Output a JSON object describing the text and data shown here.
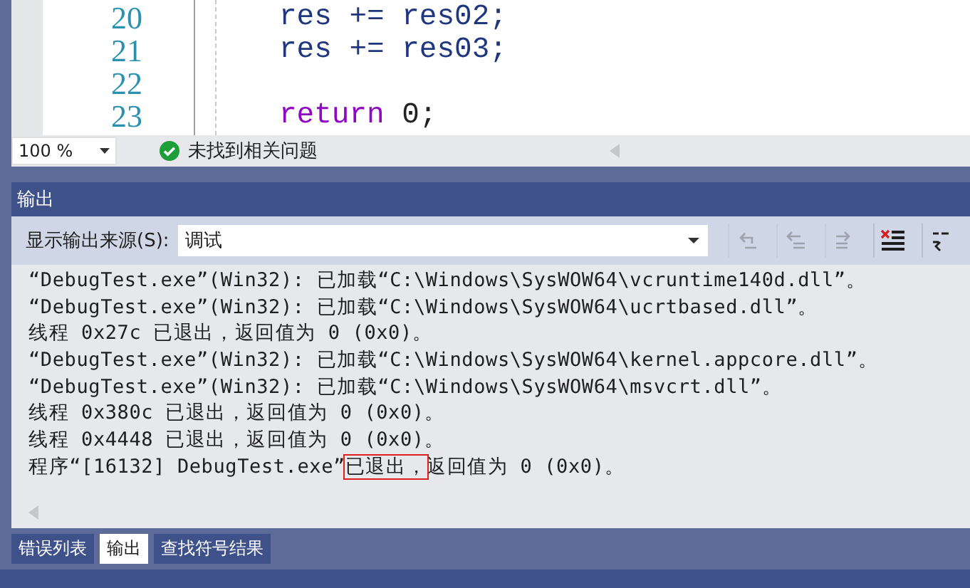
{
  "editor": {
    "lines": [
      {
        "number": "20",
        "tokens": [
          {
            "text": "res += res02;",
            "kind": "plain"
          }
        ]
      },
      {
        "number": "21",
        "tokens": [
          {
            "text": "res += res03;",
            "kind": "plain"
          }
        ]
      },
      {
        "number": "22"
      },
      {
        "number": "23",
        "tokens": [
          {
            "text": "return",
            "kind": "keyword"
          },
          {
            "text": " 0;",
            "kind": "number"
          }
        ]
      }
    ]
  },
  "status": {
    "zoom": "100 %",
    "issues": "未找到相关问题"
  },
  "output_panel": {
    "title": "输出",
    "source_label": "显示输出来源(S):",
    "source_value": "调试",
    "toolbar_buttons": [
      {
        "kind": "goto",
        "disabled": true
      },
      {
        "kind": "prev",
        "disabled": true
      },
      {
        "kind": "next",
        "disabled": true
      },
      {
        "kind": "clear",
        "disabled": false
      },
      {
        "kind": "wrap",
        "disabled": false
      }
    ],
    "lines": [
      {
        "text": "“DebugTest.exe”(Win32): 已加载“C:\\Windows\\SysWOW64\\vcruntime140d.dll”。"
      },
      {
        "text": "“DebugTest.exe”(Win32): 已加载“C:\\Windows\\SysWOW64\\ucrtbased.dll”。"
      },
      {
        "text": "线程 0x27c 已退出，返回值为 0 (0x0)。"
      },
      {
        "text": "“DebugTest.exe”(Win32): 已加载“C:\\Windows\\SysWOW64\\kernel.appcore.dll”。"
      },
      {
        "text": "“DebugTest.exe”(Win32): 已加载“C:\\Windows\\SysWOW64\\msvcrt.dll”。"
      },
      {
        "text": "线程 0x380c 已退出，返回值为 0 (0x0)。"
      },
      {
        "text": "线程 0x4448 已退出，返回值为 0 (0x0)。"
      },
      {
        "text": "程序“[16132] DebugTest.exe”",
        "highlighted": "已退出，",
        "rest": "返回值为 0 (0x0)。"
      }
    ]
  },
  "tabs": [
    {
      "label": "错误列表",
      "selected": false
    },
    {
      "label": "输出",
      "selected": true
    },
    {
      "label": "查找符号结果",
      "selected": false
    }
  ]
}
